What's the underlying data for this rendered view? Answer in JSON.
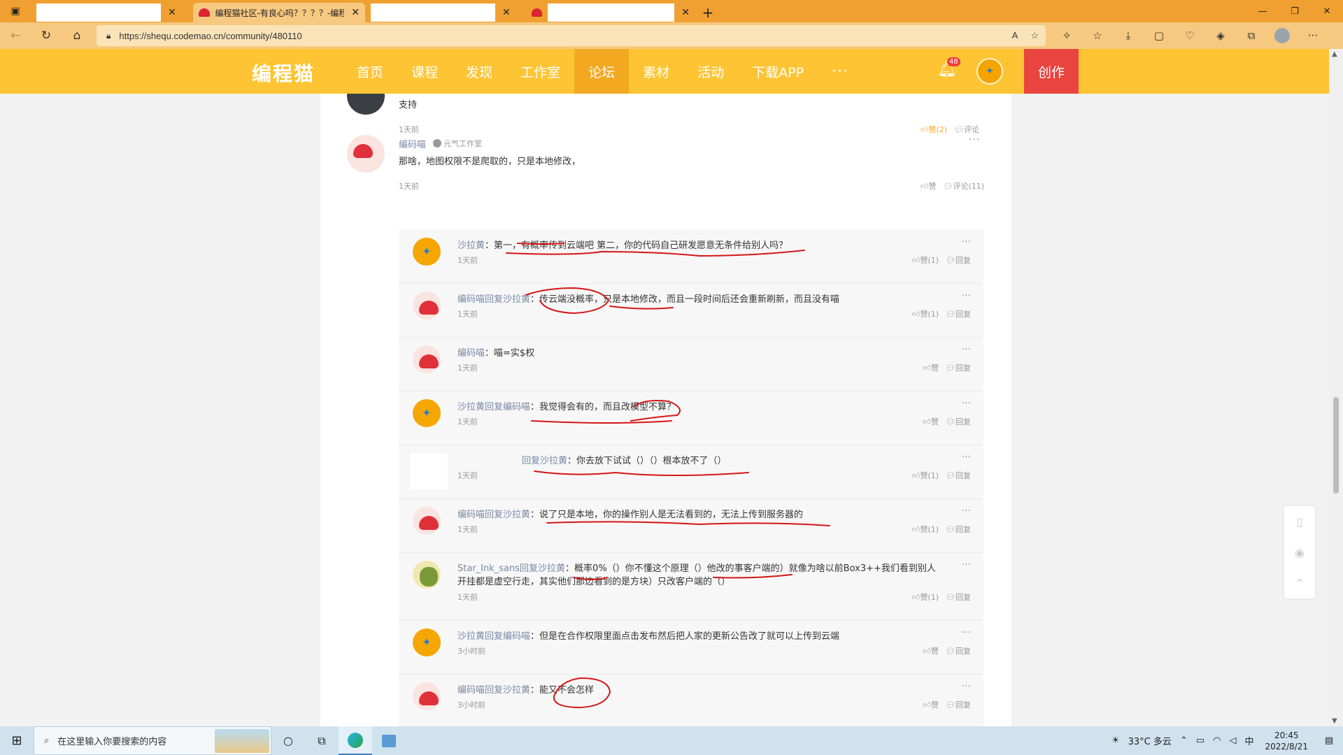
{
  "browser": {
    "tabs": [
      {
        "title": "",
        "blank": true
      },
      {
        "title": "编程猫社区-有良心吗？？？？-编程猫",
        "active": true
      },
      {
        "title": "",
        "blank": true
      },
      {
        "title": "",
        "blank": true
      }
    ],
    "url": "https://shequ.codemao.cn/community/480110"
  },
  "site": {
    "logo": "编程猫",
    "menu": [
      "首页",
      "课程",
      "发现",
      "工作室",
      "论坛",
      "素材",
      "活动",
      "下载APP",
      "···"
    ],
    "active_menu": "论坛",
    "notification_count": "48",
    "create_label": "创作"
  },
  "prev_comment": {
    "text": "支持",
    "time": "1天前",
    "like_label": "赞(2)",
    "comment_label": "评论"
  },
  "main_comment": {
    "author": "编码喵",
    "studio": "元气工作室",
    "text": "那啥，地图权限不是爬取的，只是本地修改，",
    "time": "1天前",
    "like_label": "赞",
    "comment_label": "评论(11)"
  },
  "replies": [
    {
      "name": "沙拉黄",
      "reply_to": "",
      "text": "第一，有概率传到云端吧 第二，你的代码自己研发愿意无条件给别人吗？",
      "time": "1天前",
      "like": "赞(1)",
      "reply_label": "回复",
      "avatar": "orange"
    },
    {
      "name": "编码喵",
      "reply_to": "回复沙拉黄",
      "text": "传云端没概率，只是本地修改，而且一段时间后还会重新刷新，而且没有喵",
      "time": "1天前",
      "like": "赞(1)",
      "reply_label": "回复",
      "avatar": "red"
    },
    {
      "name": "编码喵",
      "reply_to": "",
      "text": "喵=实$权",
      "time": "1天前",
      "like": "赞",
      "reply_label": "回复",
      "avatar": "red"
    },
    {
      "name": "沙拉黄",
      "reply_to": "回复编码喵",
      "text": "我觉得会有的，而且改模型不算？",
      "time": "1天前",
      "like": "赞",
      "reply_label": "回复",
      "avatar": "orange"
    },
    {
      "name": "",
      "reply_to": "回复沙拉黄",
      "text": "你去放下试试（）（）根本放不了（）",
      "time": "1天前",
      "like": "赞(1)",
      "reply_label": "回复",
      "avatar": "blank"
    },
    {
      "name": "编码喵",
      "reply_to": "回复沙拉黄",
      "text": "说了只是本地，你的操作别人是无法看到的，无法上传到服务器的",
      "time": "1天前",
      "like": "赞(1)",
      "reply_label": "回复",
      "avatar": "red"
    },
    {
      "name": "Star_Ink_sans",
      "reply_to": "回复沙拉黄",
      "text": "概率0%（）你不懂这个原理（）他改的事客户端的）就像为啥以前Box3++我们看到别人开挂都是虚空行走，其实他们那边看到的是方块）只改客户端的（）",
      "time": "1天前",
      "like": "赞(1)",
      "reply_label": "回复",
      "avatar": "green"
    },
    {
      "name": "沙拉黄",
      "reply_to": "回复编码喵",
      "text": "但是在合作权限里面点击发布然后把人家的更新公告改了就可以上传到云端",
      "time": "3小时前",
      "like": "赞",
      "reply_label": "回复",
      "avatar": "orange"
    },
    {
      "name": "编码喵",
      "reply_to": "回复沙拉黄",
      "text": "能又不会怎样",
      "time": "3小时前",
      "like": "赞",
      "reply_label": "回复",
      "avatar": "red"
    }
  ],
  "taskbar": {
    "search_placeholder": "在这里输入你要搜索的内容",
    "weather": "33°C 多云",
    "ime": "中",
    "time": "20:45",
    "date": "2022/8/21"
  }
}
